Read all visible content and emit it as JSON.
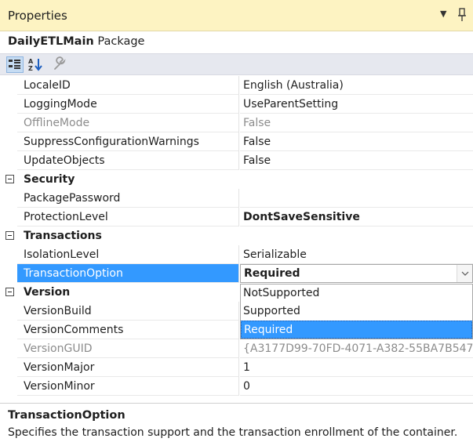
{
  "window": {
    "title": "Properties",
    "icons": {
      "dropdown": "triangle-down-icon",
      "pin": "pin-icon"
    }
  },
  "object": {
    "name": "DailyETLMain",
    "type": "Package"
  },
  "toolbar": {
    "buttons": [
      "categorized-icon",
      "alphabetical-icon",
      "property-pages-icon"
    ]
  },
  "properties": {
    "localeid": {
      "name": "LocaleID",
      "value": "English (Australia)"
    },
    "loggingmode": {
      "name": "LoggingMode",
      "value": "UseParentSetting"
    },
    "offlinemode": {
      "name": "OfflineMode",
      "value": "False"
    },
    "suppress": {
      "name": "SuppressConfigurationWarnings",
      "value": "False"
    },
    "updateobjects": {
      "name": "UpdateObjects",
      "value": "False"
    },
    "security_cat": "Security",
    "packagepassword": {
      "name": "PackagePassword",
      "value": ""
    },
    "protectionlevel": {
      "name": "ProtectionLevel",
      "value": "DontSaveSensitive"
    },
    "transactions_cat": "Transactions",
    "isolationlevel": {
      "name": "IsolationLevel",
      "value": "Serializable"
    },
    "transactionoption": {
      "name": "TransactionOption",
      "value": "Required"
    },
    "version_cat": "Version",
    "versionbuild": {
      "name": "VersionBuild",
      "value": ""
    },
    "versioncomments": {
      "name": "VersionComments",
      "value": ""
    },
    "versionguid": {
      "name": "VersionGUID",
      "value": "{A3177D99-70FD-4071-A382-55BA7B547"
    },
    "versionmajor": {
      "name": "VersionMajor",
      "value": "1"
    },
    "versionminor": {
      "name": "VersionMinor",
      "value": "0"
    }
  },
  "dropdown": {
    "options": [
      "NotSupported",
      "Supported",
      "Required"
    ],
    "selected": "Required"
  },
  "description": {
    "title": "TransactionOption",
    "text": "Specifies the transaction support and the transaction enrollment of the container."
  },
  "colors": {
    "title_bar": "#fdf3c2",
    "selection": "#3399ff",
    "toolbar": "#e6e8ef"
  }
}
